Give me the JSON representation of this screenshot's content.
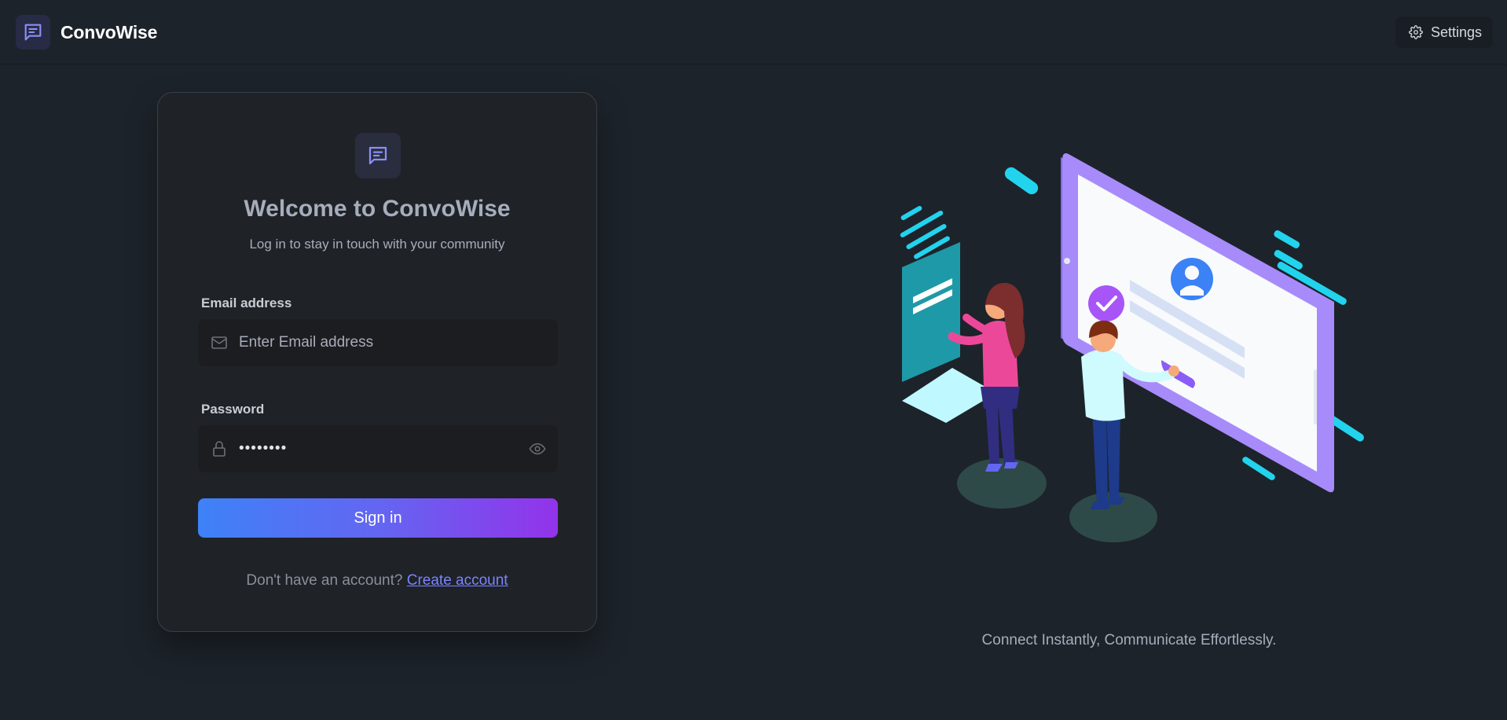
{
  "header": {
    "app_name": "ConvoWise",
    "logo_icon": "chat-message-icon",
    "settings_label": "Settings",
    "settings_icon": "gear-icon"
  },
  "login": {
    "logo_icon": "chat-message-icon",
    "title": "Welcome to ConvoWise",
    "subtitle": "Log in to stay in touch with your community",
    "email": {
      "label": "Email address",
      "placeholder": "Enter Email address",
      "value": "",
      "icon": "envelope-icon"
    },
    "password": {
      "label": "Password",
      "value": "••••••••",
      "icon": "lock-icon",
      "toggle_icon": "eye-icon"
    },
    "submit_label": "Sign in",
    "signup_prompt": "Don't have an account?",
    "signup_link": "Create account"
  },
  "hero": {
    "tagline": "Connect Instantly, Communicate Effortlessly."
  },
  "colors": {
    "background": "#1d232a",
    "card": "#1f2227",
    "accent": "#6366f1",
    "gradient_start": "#3e82f7",
    "gradient_end": "#9333ea",
    "link": "#7b84ff"
  }
}
